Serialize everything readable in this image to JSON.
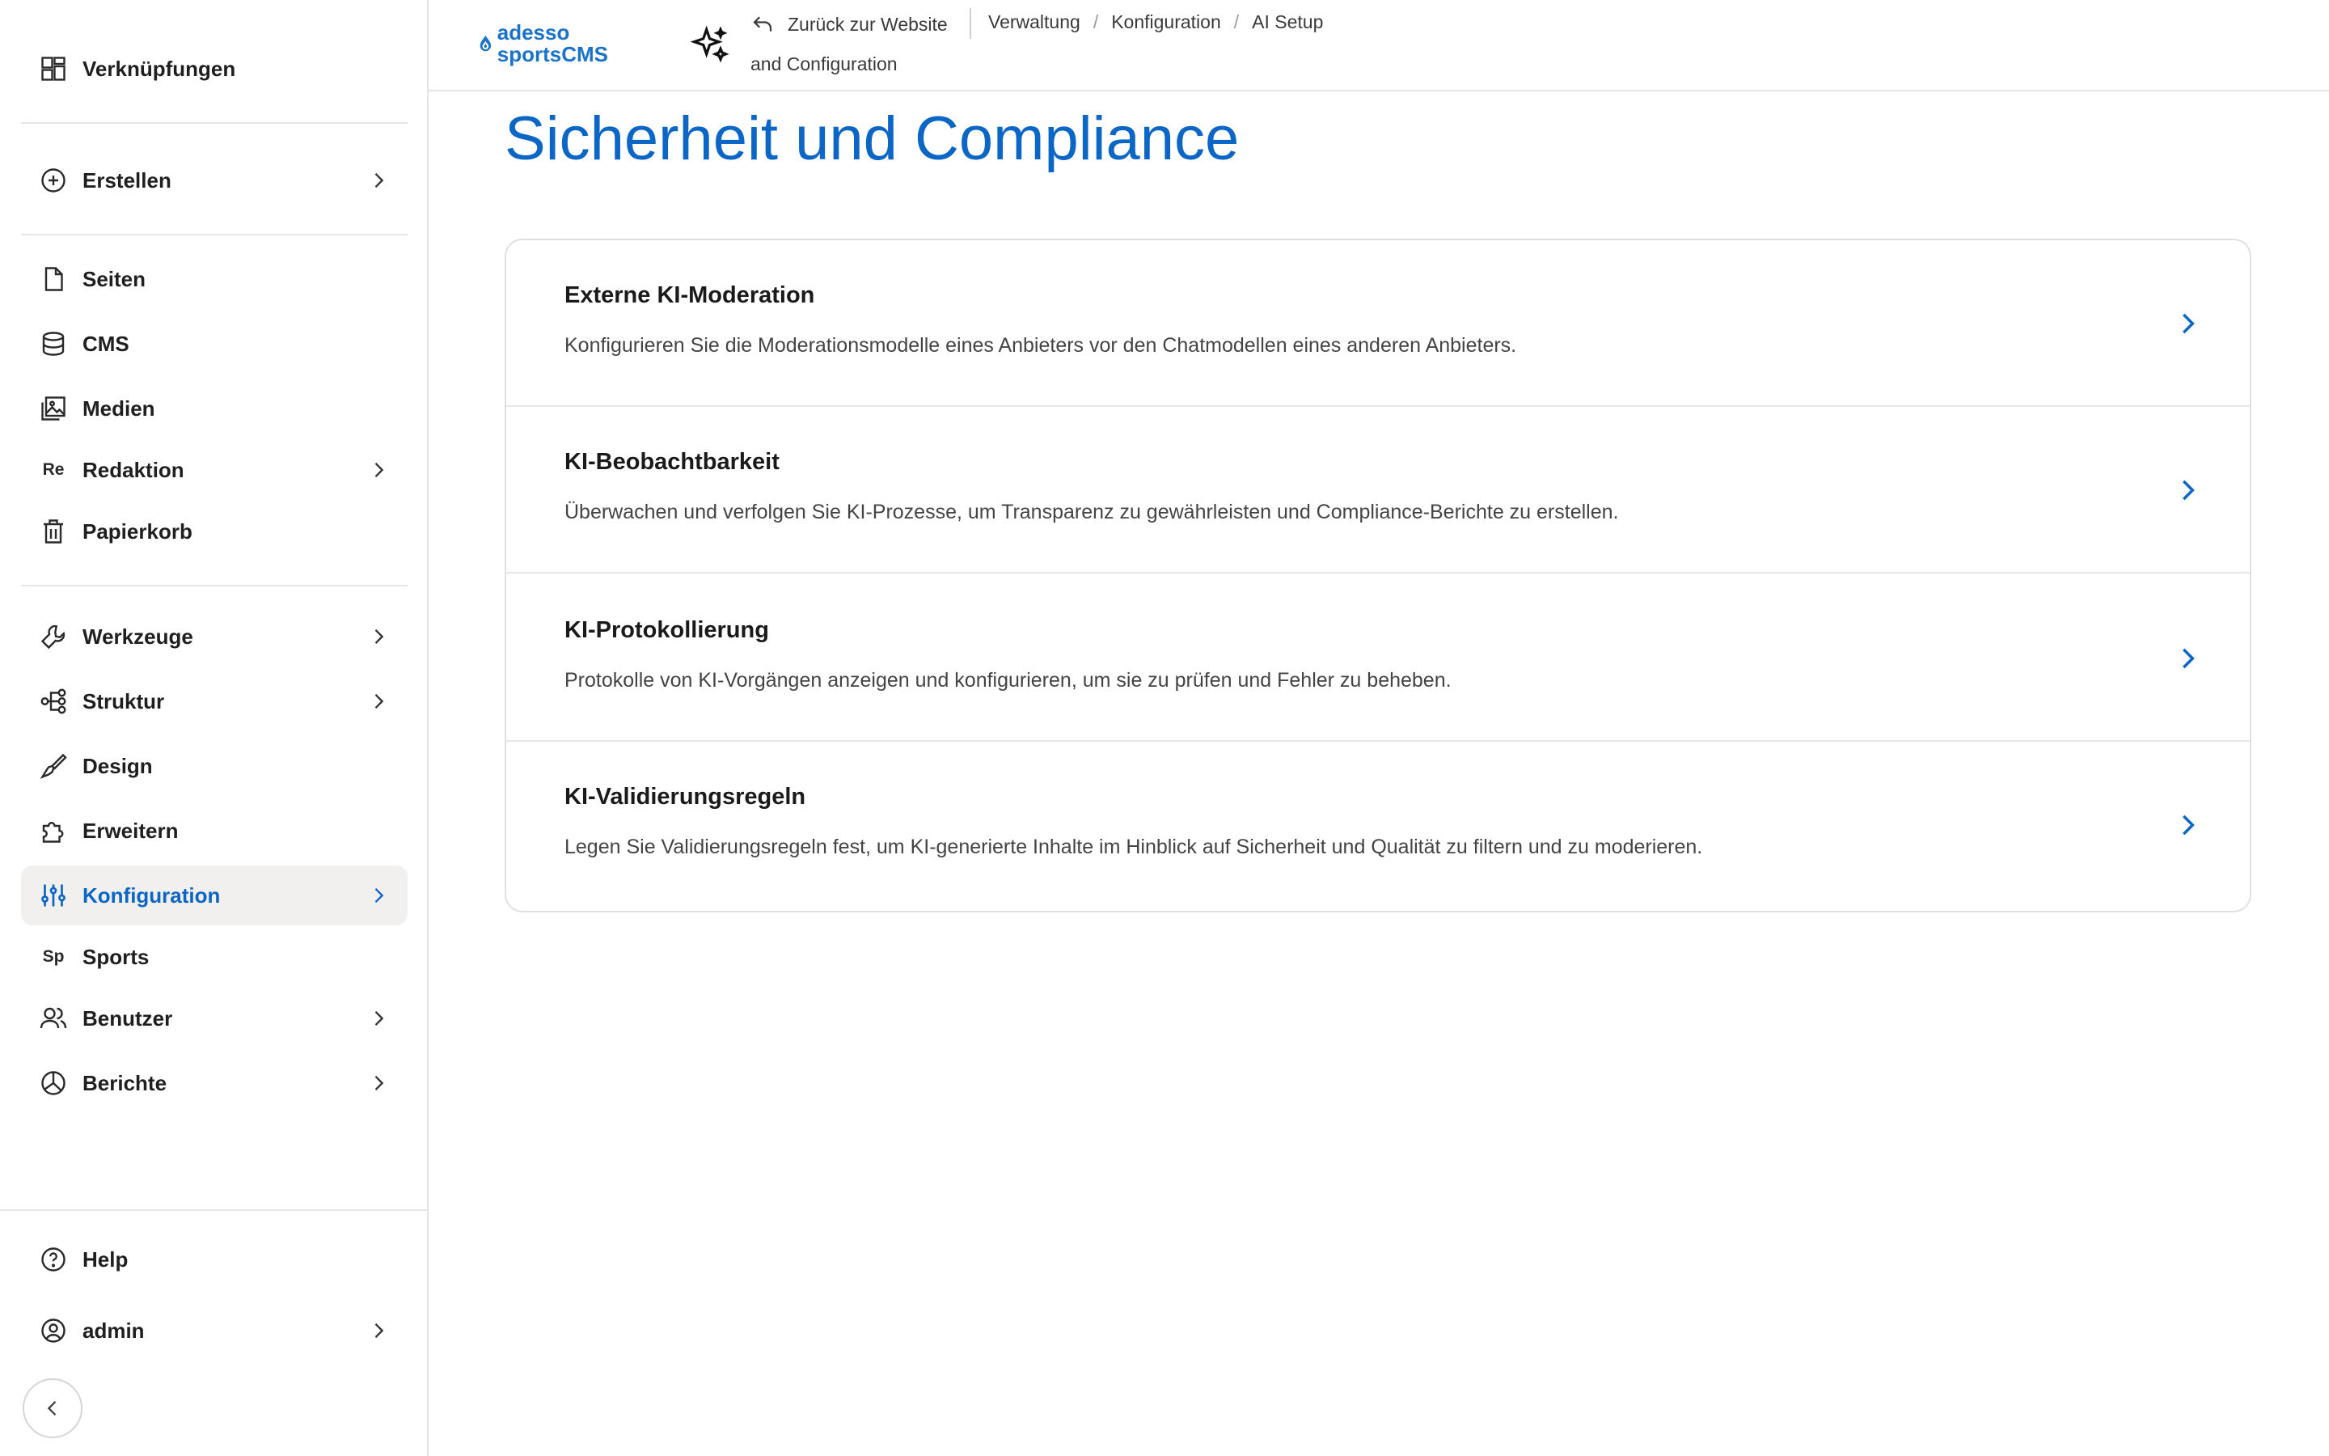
{
  "sidebar": {
    "shortcuts": {
      "label": "Verknüpfungen",
      "icon": "shortcuts-icon"
    },
    "create": {
      "label": "Erstellen",
      "icon": "plus-circle-icon"
    },
    "content_items": [
      {
        "label": "Seiten",
        "icon": "page-icon"
      },
      {
        "label": "CMS",
        "icon": "database-icon"
      },
      {
        "label": "Medien",
        "icon": "media-icon"
      },
      {
        "label": "Redaktion",
        "icon_text": "Re"
      },
      {
        "label": "Papierkorb",
        "icon": "trash-icon"
      }
    ],
    "admin_items": [
      {
        "label": "Werkzeuge",
        "icon": "wrench-icon"
      },
      {
        "label": "Struktur",
        "icon": "structure-icon"
      },
      {
        "label": "Design",
        "icon": "brush-icon"
      },
      {
        "label": "Erweitern",
        "icon": "puzzle-icon"
      },
      {
        "label": "Konfiguration",
        "icon": "sliders-icon"
      },
      {
        "label": "Sports",
        "icon_text": "Sp"
      },
      {
        "label": "Benutzer",
        "icon": "users-icon"
      },
      {
        "label": "Berichte",
        "icon": "pie-chart-icon"
      }
    ],
    "help": {
      "label": "Help",
      "icon": "help-icon"
    },
    "user": {
      "label": "admin",
      "icon": "user-circle-icon"
    }
  },
  "topbar": {
    "logo_line1": "adesso",
    "logo_line2": "sportsCMS",
    "back_label": "Zurück zur Website",
    "breadcrumbs": [
      "Verwaltung",
      "Konfiguration",
      "AI Setup"
    ],
    "breadcrumb_cont": "and Configuration"
  },
  "main": {
    "title": "Sicherheit und Compliance",
    "items": [
      {
        "title": "Externe KI-Moderation",
        "description": "Konfigurieren Sie die Moderationsmodelle eines Anbieters vor den Chatmodellen eines anderen Anbieters."
      },
      {
        "title": "KI-Beobachtbarkeit",
        "description": "Überwachen und verfolgen Sie KI-Prozesse, um Transparenz zu gewährleisten und Compliance-Berichte zu erstellen."
      },
      {
        "title": "KI-Protokollierung",
        "description": "Protokolle von KI-Vorgängen anzeigen und konfigurieren, um sie zu prüfen und Fehler zu beheben."
      },
      {
        "title": "KI-Validierungsregeln",
        "description": "Legen Sie Validierungsregeln fest, um KI-generierte Inhalte im Hinblick auf Sicherheit und Qualität zu filtern und zu moderieren."
      }
    ]
  },
  "colors": {
    "accent": "#0c66c5",
    "active_bg": "#f1f0ee",
    "border": "#e0e0e0"
  }
}
